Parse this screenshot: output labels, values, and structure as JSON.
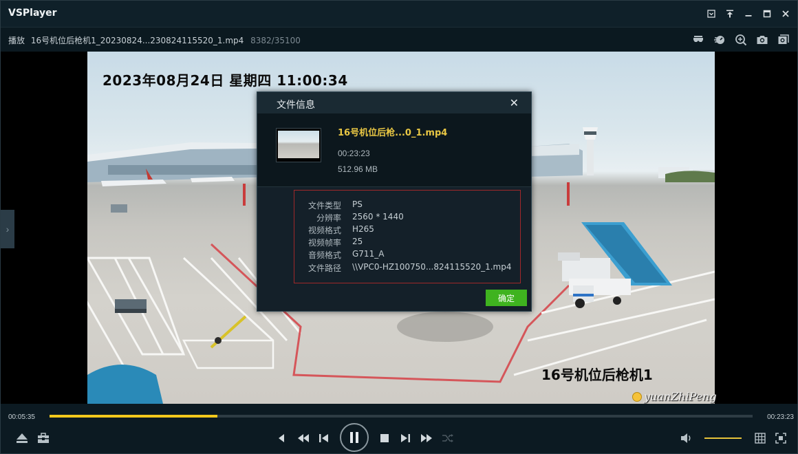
{
  "app": {
    "title": "VSPlayer"
  },
  "window_controls": [
    "minimize-to-tray",
    "pin",
    "minimize",
    "maximize",
    "close"
  ],
  "filebar": {
    "prefix": "播放",
    "filename": "16号机位后枪机1_20230824...230824115520_1.mp4",
    "frames": "8382/35100",
    "tools": [
      "vr-icon",
      "speed-icon",
      "zoom-icon",
      "snapshot-icon",
      "multi-snapshot-icon"
    ]
  },
  "video": {
    "osd_time": "2023年08月24日  星期四  11:00:34",
    "osd_camera": "16号机位后枪机1",
    "watermark": "yuanZhiPeng"
  },
  "dialog": {
    "title": "文件信息",
    "close": "✕",
    "file_name": "16号机位后枪...0_1.mp4",
    "duration": "00:23:23",
    "size": "512.96 MB",
    "info": [
      {
        "key": "文件类型",
        "value": "PS"
      },
      {
        "key": "分辨率",
        "value": "2560 * 1440"
      },
      {
        "key": "视频格式",
        "value": "H265"
      },
      {
        "key": "视频帧率",
        "value": "25"
      },
      {
        "key": "音频格式",
        "value": "G711_A"
      },
      {
        "key": "文件路径",
        "value": "\\\\VPC0-HZ100750...824115520_1.mp4"
      }
    ],
    "ok_label": "确定"
  },
  "playback": {
    "current_time": "00:05:35",
    "total_time": "00:23:23",
    "progress_fraction": 0.239,
    "volume_fraction": 1.0,
    "accent": "#f2c81c"
  }
}
